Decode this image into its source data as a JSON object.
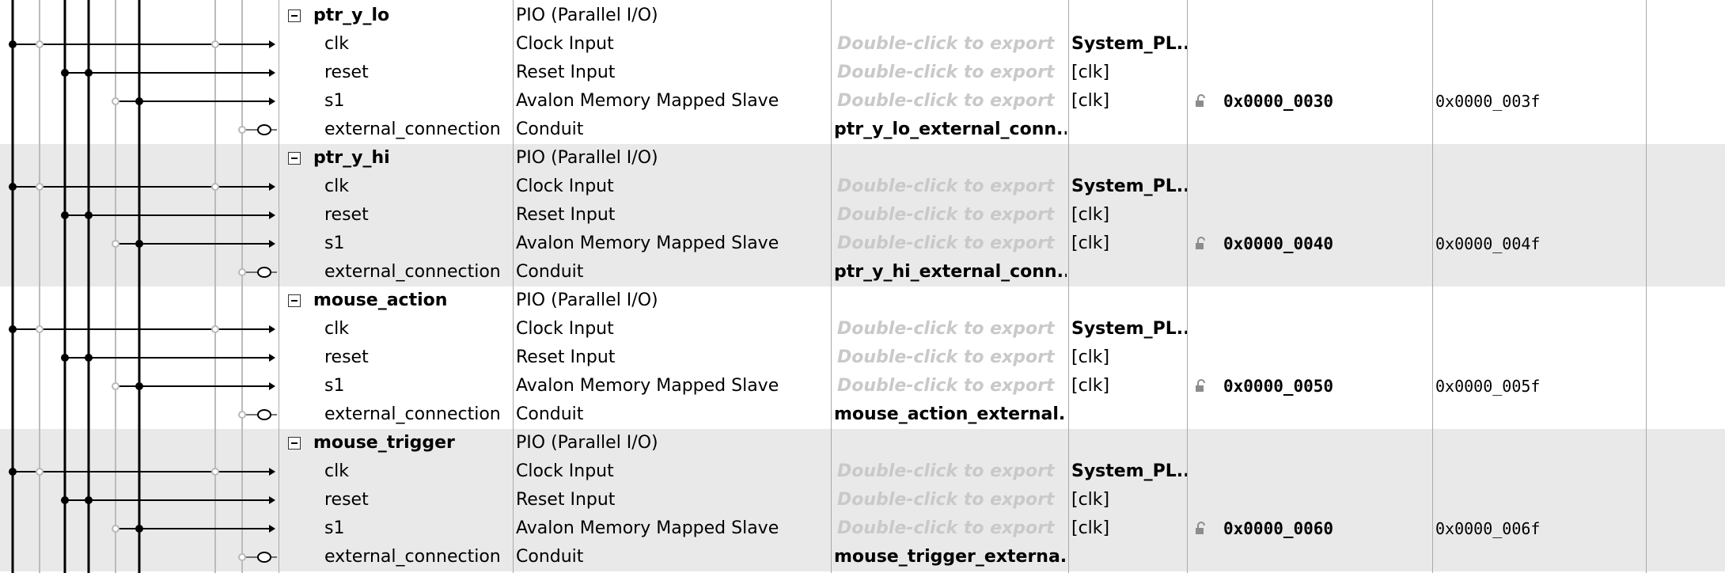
{
  "modules": [
    {
      "name": "ptr_y_lo",
      "description": "PIO (Parallel I/O)",
      "interfaces": [
        {
          "name": "clk",
          "description": "Clock Input",
          "export": "Double-click to export",
          "clock": "System_PL..."
        },
        {
          "name": "reset",
          "description": "Reset Input",
          "export": "Double-click to export",
          "clock": "[clk]"
        },
        {
          "name": "s1",
          "description": "Avalon Memory Mapped Slave",
          "export": "Double-click to export",
          "clock": "[clk]",
          "base": "0x0000_0030",
          "end": "0x0000_003f"
        },
        {
          "name": "external_connection",
          "description": "Conduit",
          "export": "ptr_y_lo_external_conn...",
          "clock": ""
        }
      ]
    },
    {
      "name": "ptr_y_hi",
      "description": "PIO (Parallel I/O)",
      "interfaces": [
        {
          "name": "clk",
          "description": "Clock Input",
          "export": "Double-click to export",
          "clock": "System_PL..."
        },
        {
          "name": "reset",
          "description": "Reset Input",
          "export": "Double-click to export",
          "clock": "[clk]"
        },
        {
          "name": "s1",
          "description": "Avalon Memory Mapped Slave",
          "export": "Double-click to export",
          "clock": "[clk]",
          "base": "0x0000_0040",
          "end": "0x0000_004f"
        },
        {
          "name": "external_connection",
          "description": "Conduit",
          "export": "ptr_y_hi_external_conn...",
          "clock": ""
        }
      ]
    },
    {
      "name": "mouse_action",
      "description": "PIO (Parallel I/O)",
      "interfaces": [
        {
          "name": "clk",
          "description": "Clock Input",
          "export": "Double-click to export",
          "clock": "System_PL..."
        },
        {
          "name": "reset",
          "description": "Reset Input",
          "export": "Double-click to export",
          "clock": "[clk]"
        },
        {
          "name": "s1",
          "description": "Avalon Memory Mapped Slave",
          "export": "Double-click to export",
          "clock": "[clk]",
          "base": "0x0000_0050",
          "end": "0x0000_005f"
        },
        {
          "name": "external_connection",
          "description": "Conduit",
          "export": "mouse_action_external...",
          "clock": ""
        }
      ]
    },
    {
      "name": "mouse_trigger",
      "description": "PIO (Parallel I/O)",
      "interfaces": [
        {
          "name": "clk",
          "description": "Clock Input",
          "export": "Double-click to export",
          "clock": "System_PL..."
        },
        {
          "name": "reset",
          "description": "Reset Input",
          "export": "Double-click to export",
          "clock": "[clk]"
        },
        {
          "name": "s1",
          "description": "Avalon Memory Mapped Slave",
          "export": "Double-click to export",
          "clock": "[clk]",
          "base": "0x0000_0060",
          "end": "0x0000_006f"
        },
        {
          "name": "external_connection",
          "description": "Conduit",
          "export": "mouse_trigger_externa...",
          "clock": ""
        }
      ]
    }
  ],
  "colors": {
    "stripe": "#e9e9e9",
    "connection_active": "#000000",
    "connection_inactive": "#b9b9b9",
    "export_placeholder": "#c9c9c9"
  }
}
